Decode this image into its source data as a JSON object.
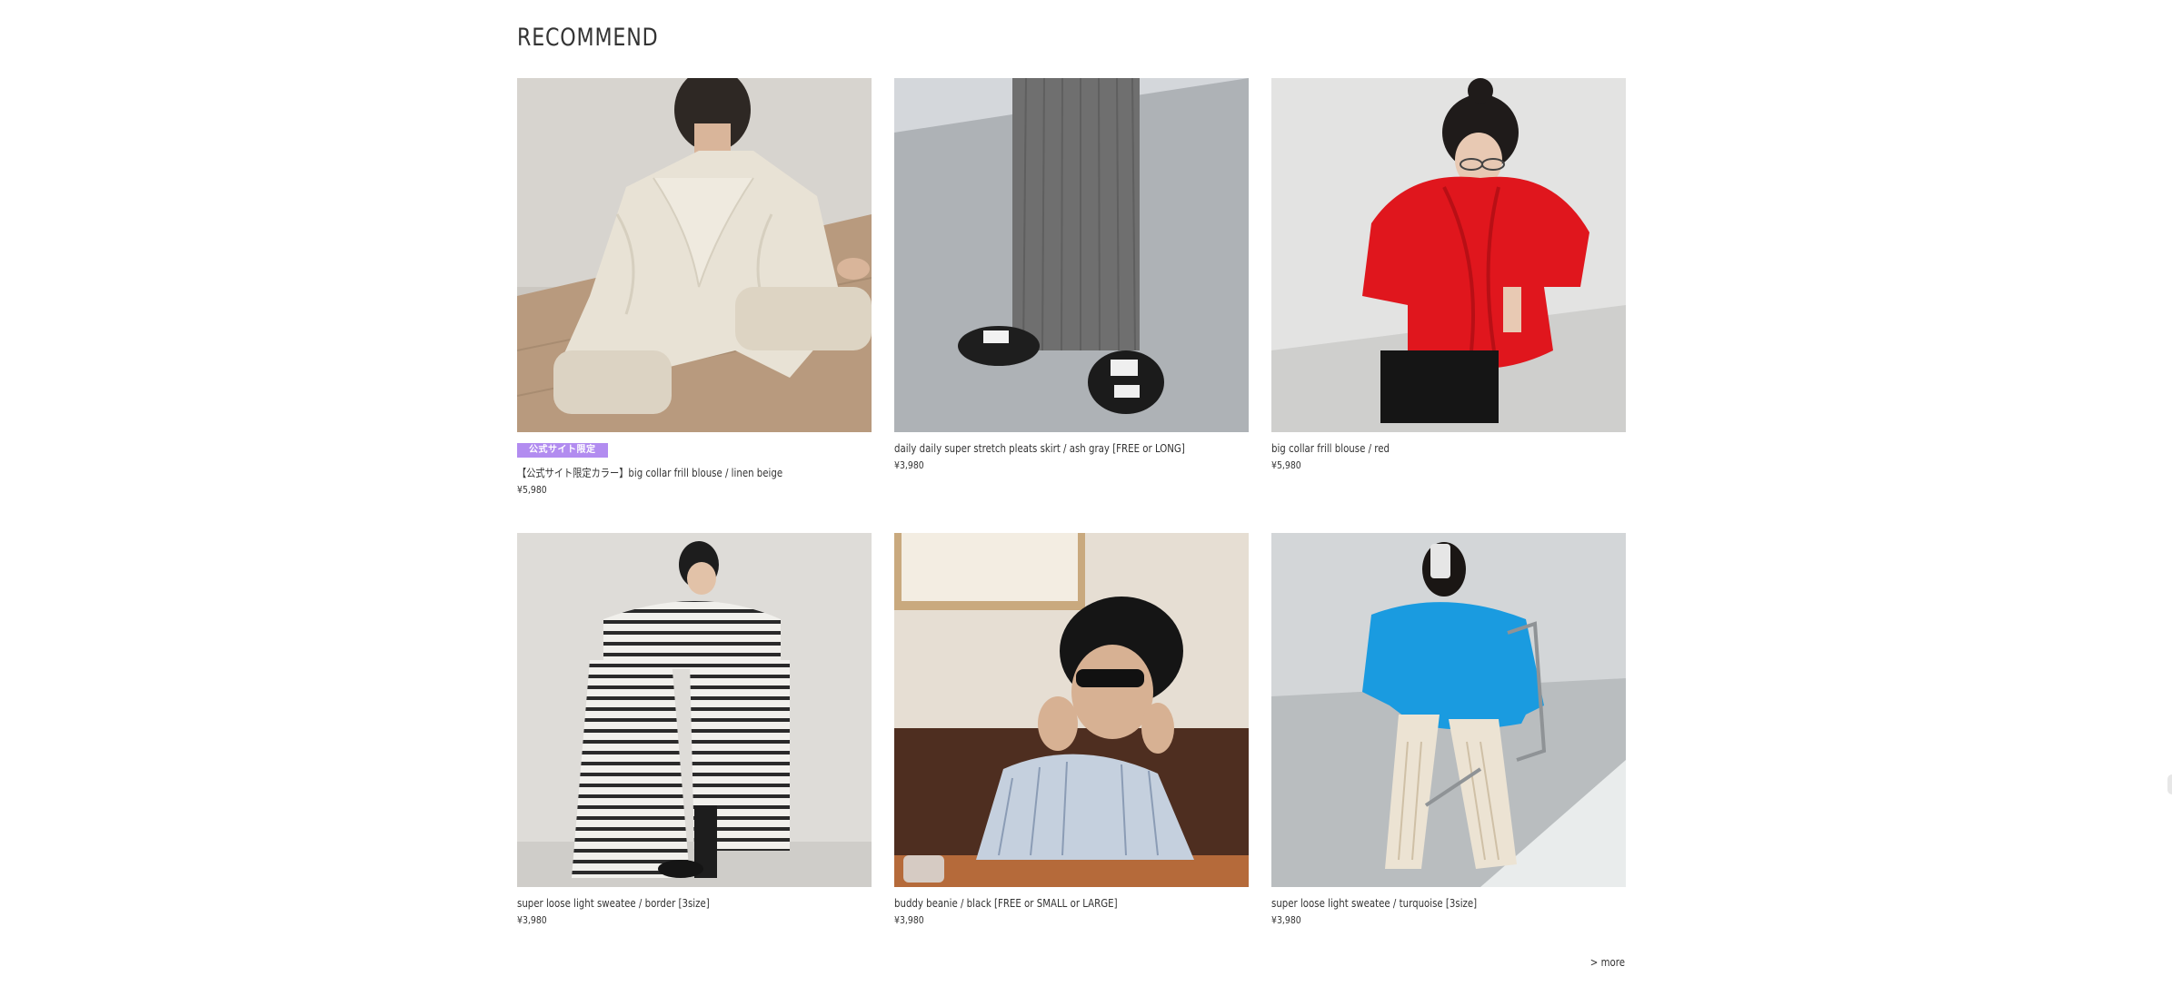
{
  "recommend": {
    "title": "RECOMMEND",
    "more_label": "> more",
    "products": [
      {
        "badge": "公式サイト限定",
        "name": "【公式サイト限定カラー】big collar frill blouse / linen beige",
        "price": "¥5,980",
        "image": "model-beige-frill-blouse-photo"
      },
      {
        "badge": "",
        "name": "daily daily super stretch pleats skirt / ash gray [FREE or LONG]",
        "price": "¥3,980",
        "image": "gray-pleats-skirt-sandals-photo"
      },
      {
        "badge": "",
        "name": "big collar frill blouse / red",
        "price": "¥5,980",
        "image": "model-red-frill-blouse-photo"
      },
      {
        "badge": "",
        "name": "super loose light sweatee / border [3size]",
        "price": "¥3,980",
        "image": "model-border-sweatees-photo"
      },
      {
        "badge": "",
        "name": "buddy beanie / black [FREE or SMALL or LARGE]",
        "price": "¥3,980",
        "image": "model-black-beanie-cafe-photo"
      },
      {
        "badge": "",
        "name": "super loose light sweatee / turquoise [3size]",
        "price": "¥3,980",
        "image": "model-turquoise-sweatee-chair-photo"
      }
    ]
  },
  "colors": {
    "badge": "#b28cf0",
    "text": "#333333",
    "background": "#ffffff"
  }
}
